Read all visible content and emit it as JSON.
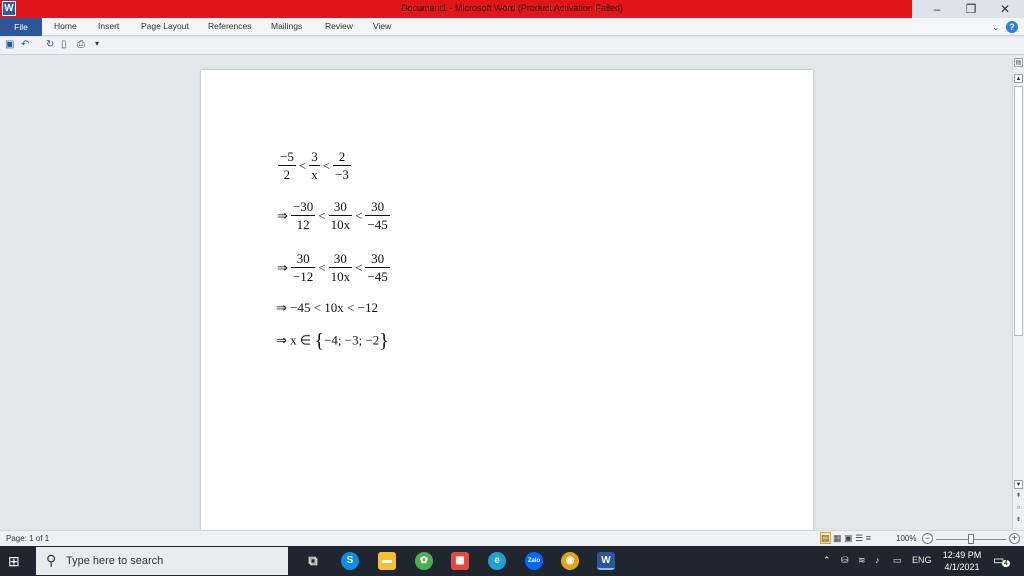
{
  "window": {
    "title": "Document1 - Microsoft Word (Product Activation Failed)",
    "app_icon_letter": "W",
    "controls": [
      "–",
      "❐",
      "✕"
    ]
  },
  "ribbon": {
    "file_tab": "File",
    "tabs": [
      "Home",
      "Insert",
      "Page Layout",
      "References",
      "Mailings",
      "Review",
      "View"
    ],
    "right_chevron": "⌄",
    "help": "?"
  },
  "qat": {
    "icons": [
      "save-icon",
      "undo-icon",
      "redo-icon",
      "new-doc-icon",
      "print-preview-icon",
      "customize-icon"
    ]
  },
  "document": {
    "lines": [
      {
        "prefix": "",
        "fractions": [
          [
            "−5",
            "2"
          ],
          [
            "3",
            "x"
          ],
          [
            "2",
            "−3"
          ]
        ]
      },
      {
        "prefix": "⇒",
        "fractions": [
          [
            "−30",
            "12"
          ],
          [
            "30",
            "10x"
          ],
          [
            "30",
            "−45"
          ]
        ]
      },
      {
        "prefix": "⇒",
        "fractions": [
          [
            "30",
            "−12"
          ],
          [
            "30",
            "10x"
          ],
          [
            "30",
            "−45"
          ]
        ]
      }
    ],
    "line4": "⇒ −45 < 10x < −12",
    "line5_prefix": "⇒ x ∈",
    "line5_set": "−4; −3; −2",
    "less_than": "<"
  },
  "statusbar": {
    "page": "Page: 1 of 1",
    "zoom_label": "100%",
    "zoom_minus": "−",
    "zoom_plus": "+",
    "zoom_level": 0.5
  },
  "taskbar": {
    "search_placeholder": "Type here to search",
    "tray_lang": "ENG",
    "time": "12:49 PM",
    "date": "4/1/2021",
    "notification_count": "4",
    "app_colors": {
      "skype": "#0a8ee8",
      "explorer": "#f4c430",
      "game": "#4caf50",
      "apps": "#e24a3b",
      "edge": "#1fa0d8",
      "zalo": "#0068ff",
      "chrome": "#e0a51b",
      "word": "#2b579a"
    }
  }
}
